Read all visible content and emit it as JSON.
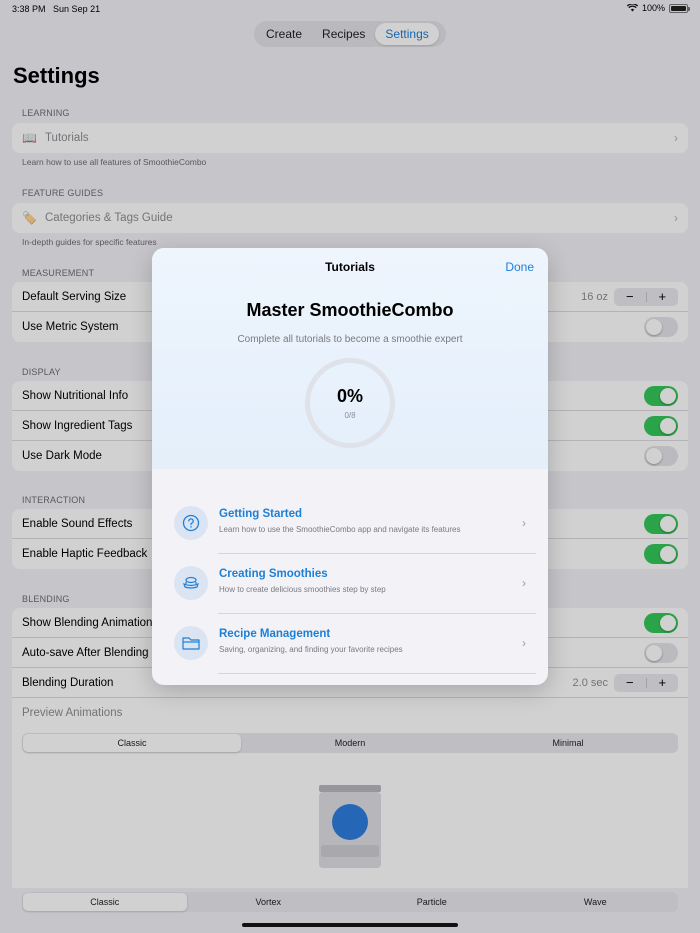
{
  "status_bar": {
    "time": "3:38 PM",
    "date": "Sun Sep 21",
    "battery": "100%"
  },
  "tabs": [
    "Create",
    "Recipes",
    "Settings"
  ],
  "page_title": "Settings",
  "learning": {
    "header": "LEARNING",
    "tutorials_label": "Tutorials",
    "footer": "Learn how to use all features of SmoothieCombo"
  },
  "feature_guides": {
    "header": "FEATURE GUIDES",
    "categories_label": "Categories & Tags Guide",
    "footer": "In-depth guides for specific features"
  },
  "measurement": {
    "header": "MEASUREMENT",
    "serving_label": "Default Serving Size",
    "serving_value": "16 oz",
    "metric_label": "Use Metric System"
  },
  "display": {
    "header": "DISPLAY",
    "nutritional_label": "Show Nutritional Info",
    "tags_label": "Show Ingredient Tags",
    "dark_label": "Use Dark Mode"
  },
  "interaction": {
    "header": "INTERACTION",
    "sound_label": "Enable Sound Effects",
    "haptic_label": "Enable Haptic Feedback"
  },
  "blending": {
    "header": "BLENDING",
    "animation_label": "Show Blending Animation",
    "autosave_label": "Auto-save After Blending",
    "duration_label": "Blending Duration",
    "duration_value": "2.0 sec",
    "preview_label": "Preview Animations",
    "style_options": [
      "Classic",
      "Modern",
      "Minimal"
    ],
    "animation_options": [
      "Classic",
      "Vortex",
      "Particle",
      "Wave"
    ]
  },
  "stepper": {
    "minus": "−",
    "plus": "+"
  },
  "modal": {
    "title": "Tutorials",
    "done": "Done",
    "heading": "Master SmoothieCombo",
    "subtitle": "Complete all tutorials to become a smoothie expert",
    "progress_percent": "0%",
    "progress_count": "0/8",
    "items": [
      {
        "title": "Getting Started",
        "desc": "Learn how to use the SmoothieCombo app and navigate its features",
        "icon": "question-circle-icon"
      },
      {
        "title": "Creating Smoothies",
        "desc": "How to create delicious smoothies step by step",
        "icon": "cup-icon"
      },
      {
        "title": "Recipe Management",
        "desc": "Saving, organizing, and finding your favorite recipes",
        "icon": "folder-icon"
      }
    ]
  },
  "colors": {
    "accent": "#1e7fd6",
    "toggle_on": "#34c759"
  }
}
